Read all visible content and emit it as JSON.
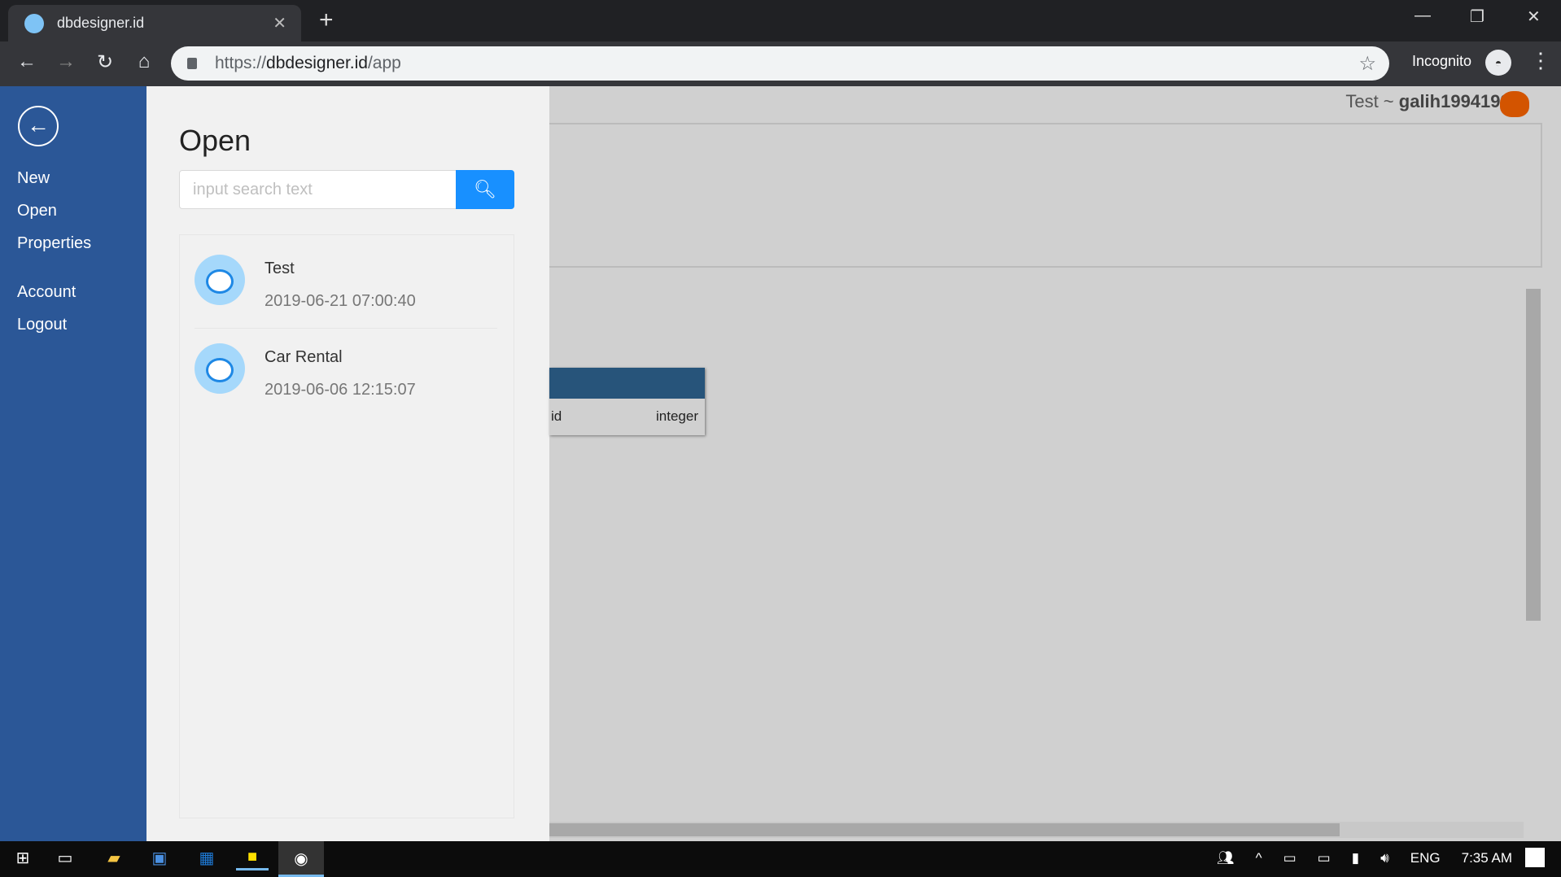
{
  "browser": {
    "tab_title": "dbdesigner.id",
    "url_scheme": "https://",
    "url_domain": "dbdesigner.id",
    "url_path": "/app",
    "incognito_label": "Incognito"
  },
  "sidebar": {
    "items": [
      {
        "label": "New"
      },
      {
        "label": "Open"
      },
      {
        "label": "Properties"
      },
      {
        "label": "Account"
      },
      {
        "label": "Logout"
      }
    ]
  },
  "panel": {
    "title": "Open",
    "search_placeholder": "input search text",
    "projects": [
      {
        "name": "Test",
        "date": "2019-06-21 07:00:40"
      },
      {
        "name": "Car Rental",
        "date": "2019-06-06 12:15:07"
      }
    ]
  },
  "header": {
    "project": "Test",
    "separator": " ~ ",
    "username": "galih19941994"
  },
  "canvas": {
    "table": {
      "field": "id",
      "type": "integer"
    }
  },
  "taskbar": {
    "lang": "ENG",
    "time": "7:35 AM"
  },
  "colors": {
    "sidebar": "#2b5797",
    "accent": "#1890ff",
    "table_header": "#27547a"
  }
}
